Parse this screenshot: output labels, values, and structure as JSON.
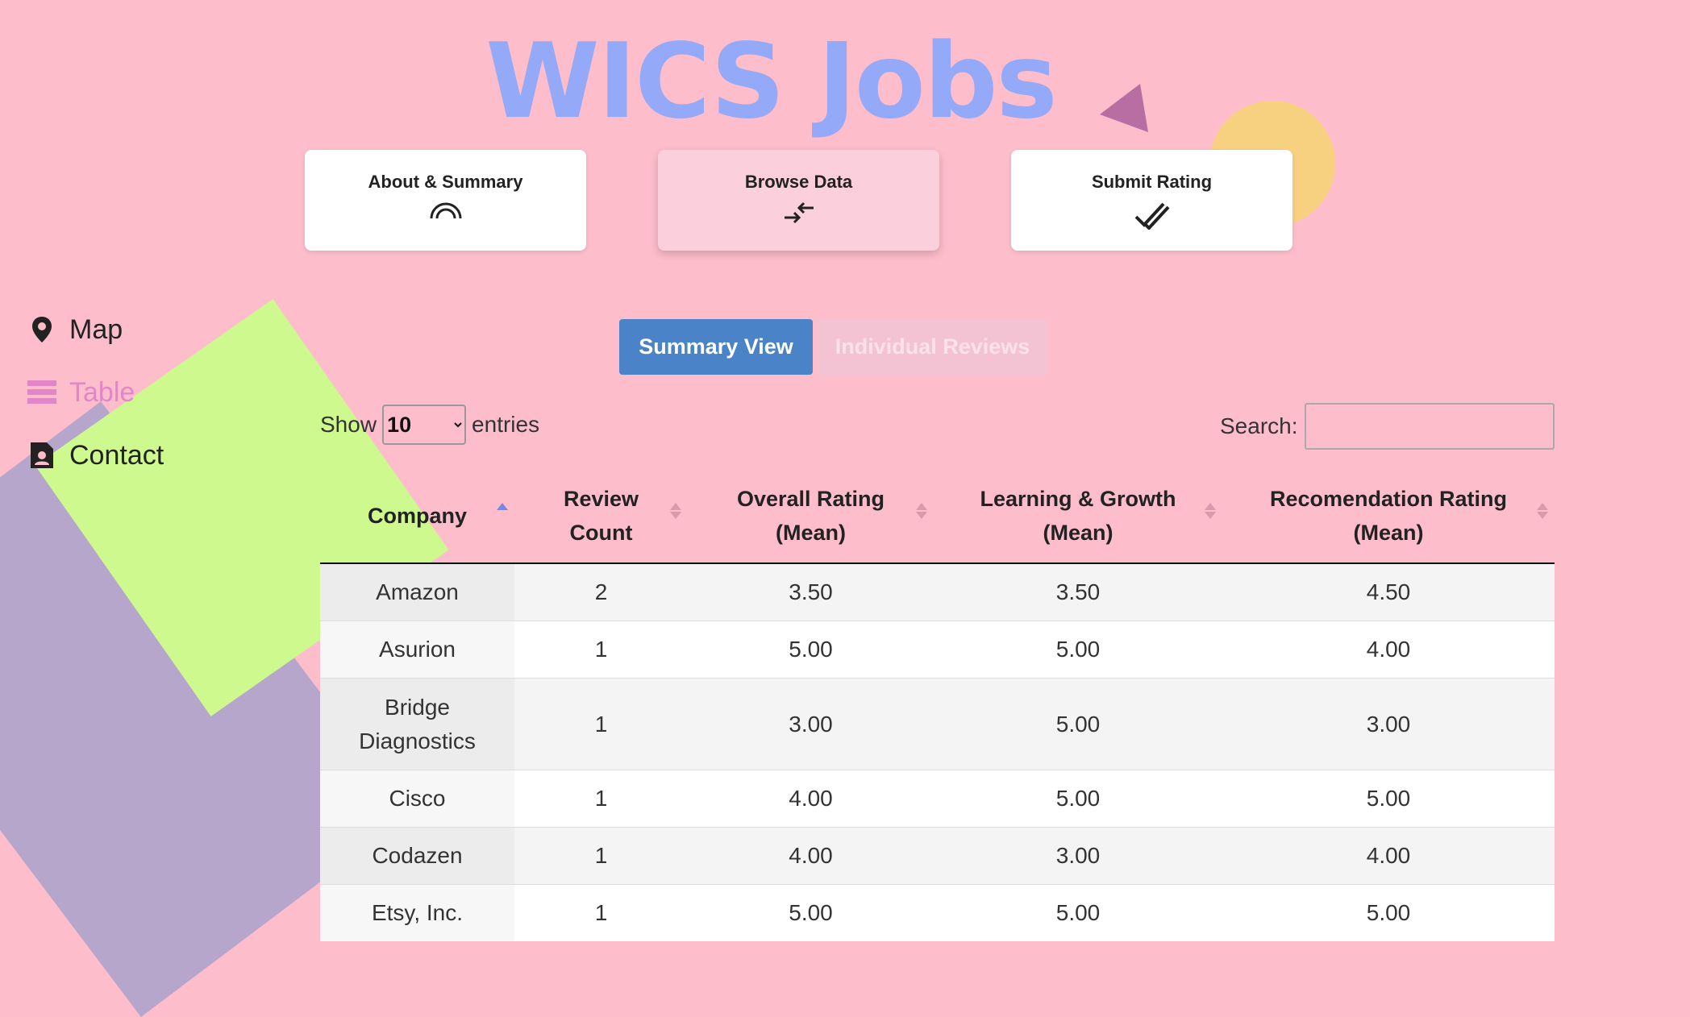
{
  "logo": {
    "text": "WICS Jobs"
  },
  "nav": {
    "about": {
      "label": "About & Summary",
      "icon": "rainbow-icon"
    },
    "browse": {
      "label": "Browse Data",
      "icon": "arrows-compress-icon"
    },
    "submit": {
      "label": "Submit Rating",
      "icon": "double-check-icon"
    }
  },
  "sidebar": {
    "items": [
      {
        "label": "Map",
        "icon": "map-pin-icon",
        "active": false
      },
      {
        "label": "Table",
        "icon": "table-lines-icon",
        "active": true
      },
      {
        "label": "Contact",
        "icon": "contact-card-icon",
        "active": false
      }
    ]
  },
  "views": {
    "summary": "Summary View",
    "individual": "Individual Reviews"
  },
  "controls": {
    "show": "Show",
    "entries": "entries",
    "page_length": "10",
    "search_label": "Search:"
  },
  "table": {
    "headers": [
      {
        "line1": "Company",
        "line2": ""
      },
      {
        "line1": "Review",
        "line2": "Count"
      },
      {
        "line1": "Overall Rating",
        "line2": "(Mean)"
      },
      {
        "line1": "Learning & Growth",
        "line2": "(Mean)"
      },
      {
        "line1": "Recomendation Rating",
        "line2": "(Mean)"
      }
    ],
    "rows": [
      {
        "company": "Amazon",
        "company2": "",
        "count": "2",
        "overall": "3.50",
        "learning": "3.50",
        "recommend": "4.50"
      },
      {
        "company": "Asurion",
        "company2": "",
        "count": "1",
        "overall": "5.00",
        "learning": "5.00",
        "recommend": "4.00"
      },
      {
        "company": "Bridge",
        "company2": "Diagnostics",
        "count": "1",
        "overall": "3.00",
        "learning": "5.00",
        "recommend": "3.00"
      },
      {
        "company": "Cisco",
        "company2": "",
        "count": "1",
        "overall": "4.00",
        "learning": "5.00",
        "recommend": "5.00"
      },
      {
        "company": "Codazen",
        "company2": "",
        "count": "1",
        "overall": "4.00",
        "learning": "3.00",
        "recommend": "4.00"
      },
      {
        "company": "Etsy, Inc.",
        "company2": "",
        "count": "1",
        "overall": "5.00",
        "learning": "5.00",
        "recommend": "5.00"
      }
    ]
  },
  "colors": {
    "background": "#fdbdca",
    "logo": "#94a9f7",
    "active_side": "#e186c9",
    "primary_button": "#4a83c8"
  }
}
